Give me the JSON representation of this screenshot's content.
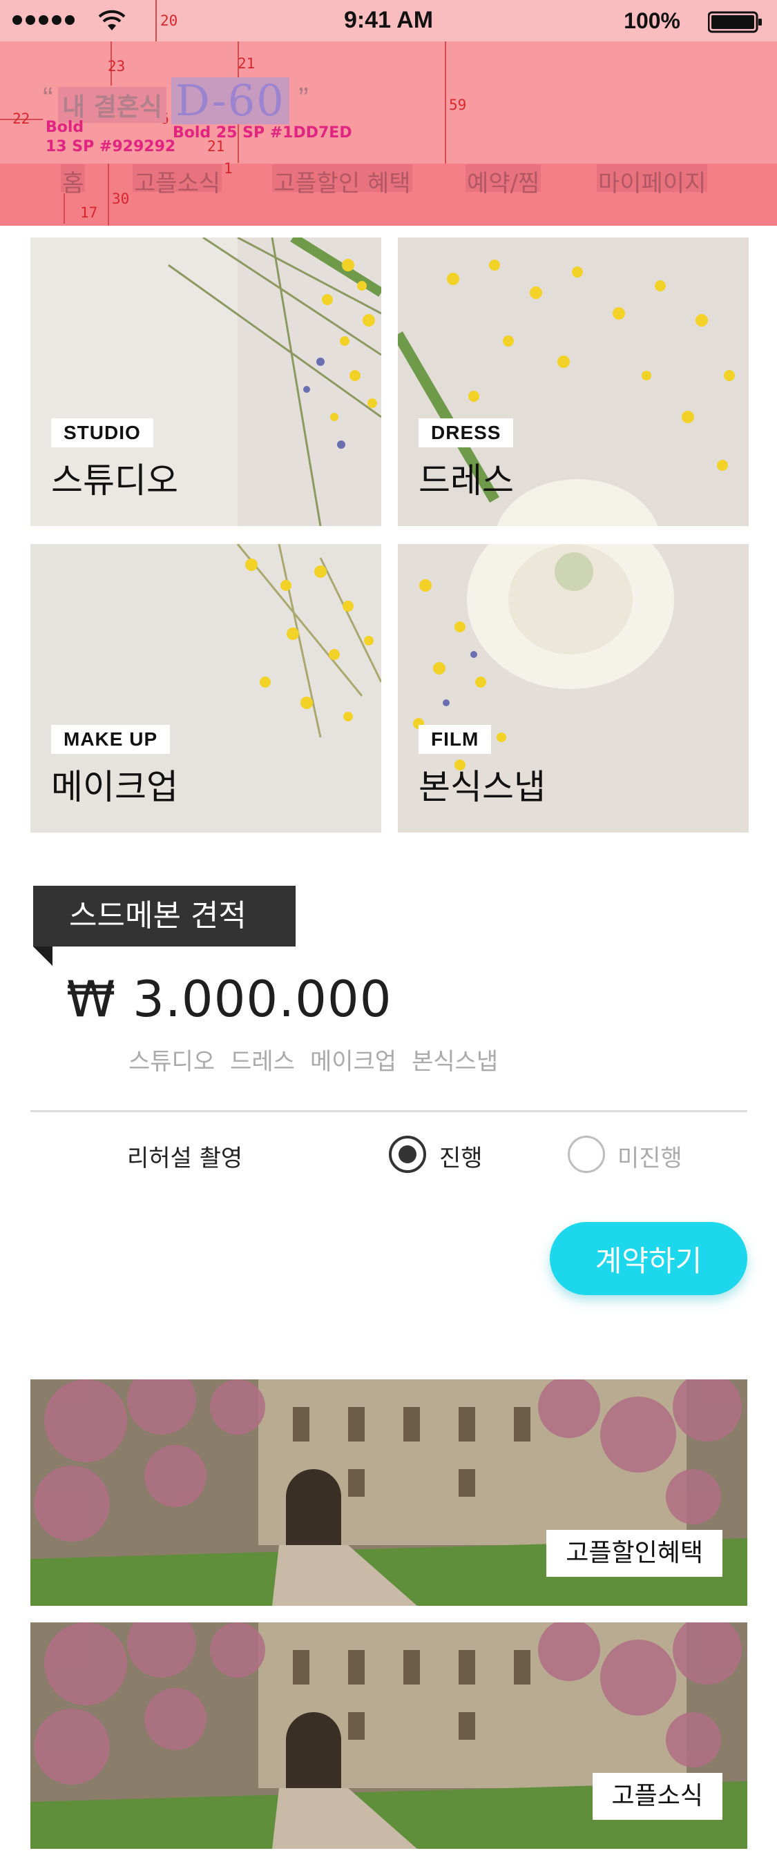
{
  "status_bar": {
    "time": "9:41 AM",
    "battery": "100%"
  },
  "header": {
    "quote_open": "“",
    "label": "내 결혼식",
    "d_day": "D-60",
    "quote_close": "”"
  },
  "spec": {
    "gap_top": "20",
    "gap_label_top": "23",
    "gap_dday_top": "21",
    "gap_left": "22",
    "gap_between": "6",
    "header_height": "59",
    "gap_bottom": "21",
    "gap_tab": "1",
    "tab_padding": "30",
    "tab_left": "17",
    "label_style": "Bold",
    "label_spec": "13 SP #929292",
    "dday_spec": "Bold 25 SP #1DD7ED"
  },
  "tabs": [
    "홈",
    "고플소식",
    "고플할인 혜택",
    "예약/찜",
    "마이페이지"
  ],
  "categories": [
    {
      "tag": "STUDIO",
      "title": "스튜디오"
    },
    {
      "tag": "DRESS",
      "title": "드레스"
    },
    {
      "tag": "MAKE UP",
      "title": "메이크업"
    },
    {
      "tag": "FILM",
      "title": "본식스냅"
    }
  ],
  "estimate": {
    "title": "스드메본 견적",
    "price": "₩ 3.000.000",
    "items": [
      "스튜디오",
      "드레스",
      "메이크업",
      "본식스냅"
    ]
  },
  "rehearsal": {
    "label": "리허설 촬영",
    "option_on": "진행",
    "option_off": "미진행",
    "selected": "진행"
  },
  "contract_button": "계약하기",
  "banners": [
    {
      "label": "고플할인혜택"
    },
    {
      "label": "고플소식"
    }
  ],
  "colors": {
    "accent": "#1DD7ED",
    "label_gray": "#929292",
    "ribbon": "#333333"
  }
}
